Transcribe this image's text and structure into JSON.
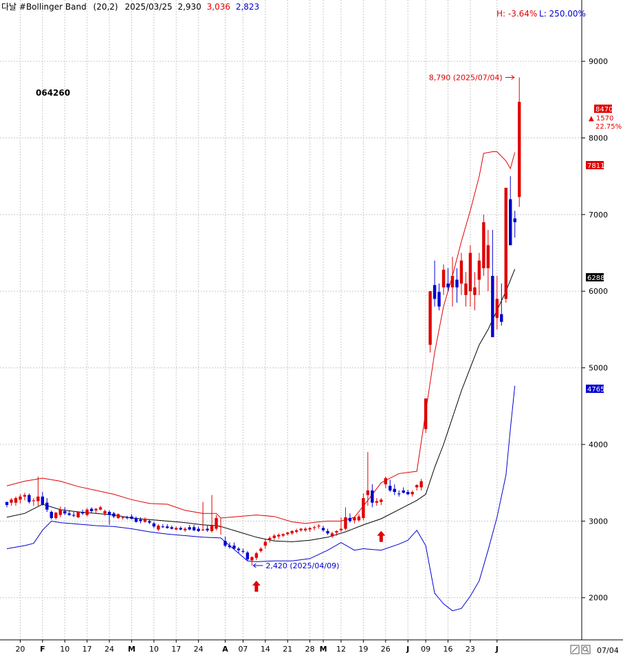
{
  "chart_data": {
    "type": "candlestick",
    "header": {
      "name": "다날 #Bollinger Band",
      "params": "(20,2)",
      "date": "2025/03/25",
      "value1": "2,930",
      "value2": "3,036",
      "value3": "2,823"
    },
    "hl_stats": {
      "high": "H: -3.64%",
      "low": "L: 250.00%"
    },
    "code": "064260",
    "ylim": [
      1450,
      9800
    ],
    "y_ticks": [
      {
        "value": 2000,
        "label": "2000"
      },
      {
        "value": 3000,
        "label": "3000"
      },
      {
        "value": 4000,
        "label": "4000"
      },
      {
        "value": 5000,
        "label": "5000"
      },
      {
        "value": 6000,
        "label": "6000"
      },
      {
        "value": 7000,
        "label": "7000"
      },
      {
        "value": 8000,
        "label": "8000"
      },
      {
        "value": 9000,
        "label": "9000"
      }
    ],
    "x_ticks": [
      {
        "label": "20",
        "index": 3
      },
      {
        "label": "F",
        "index": 8,
        "bold": true
      },
      {
        "label": "10",
        "index": 13
      },
      {
        "label": "17",
        "index": 18
      },
      {
        "label": "24",
        "index": 23
      },
      {
        "label": "M",
        "index": 28,
        "bold": true
      },
      {
        "label": "10",
        "index": 33
      },
      {
        "label": "17",
        "index": 38
      },
      {
        "label": "24",
        "index": 43
      },
      {
        "label": "A",
        "index": 49,
        "bold": true
      },
      {
        "label": "07",
        "index": 53
      },
      {
        "label": "14",
        "index": 58
      },
      {
        "label": "21",
        "index": 63
      },
      {
        "label": "28",
        "index": 68
      },
      {
        "label": "M",
        "index": 71,
        "bold": true
      },
      {
        "label": "12",
        "index": 75
      },
      {
        "label": "19",
        "index": 80
      },
      {
        "label": "26",
        "index": 85
      },
      {
        "label": "J",
        "index": 90,
        "bold": true
      },
      {
        "label": "09",
        "index": 94
      },
      {
        "label": "16",
        "index": 99
      },
      {
        "label": "23",
        "index": 104
      },
      {
        "label": "J",
        "index": 110,
        "bold": true
      }
    ],
    "last_date_label": "07/04",
    "right_labels": {
      "upper": "7811",
      "middle": "6288",
      "lower": "4765",
      "close": "8470",
      "change": "▲ 1570",
      "change_pct": "22.75%"
    },
    "high_annotation": {
      "label": "8,790 (2025/07/04)",
      "value": 8790,
      "index": 114
    },
    "low_annotation": {
      "label": "2,420 (2025/04/09)",
      "value": 2420,
      "index": 55
    },
    "arrows": [
      {
        "index": 56,
        "value": 2150
      },
      {
        "index": 84,
        "value": 2800
      }
    ],
    "candles": [
      [
        3250,
        3250,
        3180,
        3210
      ],
      [
        3240,
        3300,
        3200,
        3280
      ],
      [
        3240,
        3320,
        3200,
        3300
      ],
      [
        3280,
        3350,
        3230,
        3320
      ],
      [
        3320,
        3370,
        3270,
        3340
      ],
      [
        3340,
        3360,
        3230,
        3250
      ],
      [
        3260,
        3300,
        3200,
        3270
      ],
      [
        3260,
        3580,
        3200,
        3320
      ],
      [
        3320,
        3380,
        3200,
        3220
      ],
      [
        3240,
        3300,
        3120,
        3150
      ],
      [
        3120,
        3140,
        3020,
        3040
      ],
      [
        3040,
        3120,
        3020,
        3110
      ],
      [
        3080,
        3190,
        3050,
        3150
      ],
      [
        3130,
        3180,
        3080,
        3100
      ],
      [
        3100,
        3140,
        3070,
        3080
      ],
      [
        3080,
        3120,
        3050,
        3070
      ],
      [
        3050,
        3130,
        3040,
        3120
      ],
      [
        3120,
        3150,
        3080,
        3100
      ],
      [
        3080,
        3170,
        3060,
        3150
      ],
      [
        3160,
        3180,
        3110,
        3130
      ],
      [
        3140,
        3170,
        3100,
        3160
      ],
      [
        3150,
        3200,
        3140,
        3180
      ],
      [
        3100,
        3150,
        3070,
        3130
      ],
      [
        3120,
        3140,
        2950,
        3080
      ],
      [
        3100,
        3120,
        3040,
        3060
      ],
      [
        3040,
        3100,
        3030,
        3090
      ],
      [
        3040,
        3060,
        3020,
        3050
      ],
      [
        3050,
        3070,
        3020,
        3040
      ],
      [
        3060,
        3090,
        3020,
        3030
      ],
      [
        3040,
        3060,
        2980,
        2990
      ],
      [
        3020,
        3050,
        2970,
        3000
      ],
      [
        2990,
        3050,
        2980,
        3030
      ],
      [
        3000,
        3020,
        2960,
        2980
      ],
      [
        2970,
        2990,
        2910,
        2930
      ],
      [
        2890,
        2960,
        2870,
        2940
      ],
      [
        2930,
        2960,
        2910,
        2920
      ],
      [
        2930,
        2960,
        2900,
        2910
      ],
      [
        2920,
        2940,
        2890,
        2900
      ],
      [
        2890,
        2930,
        2880,
        2910
      ],
      [
        2910,
        2930,
        2880,
        2890
      ],
      [
        2880,
        2920,
        2860,
        2900
      ],
      [
        2920,
        2950,
        2880,
        2890
      ],
      [
        2920,
        2950,
        2870,
        2880
      ],
      [
        2900,
        2930,
        2860,
        2870
      ],
      [
        2880,
        3250,
        2870,
        2890
      ],
      [
        2900,
        2940,
        2860,
        2880
      ],
      [
        2870,
        3340,
        2850,
        2940
      ],
      [
        2900,
        3080,
        2880,
        3040
      ],
      [
        2930,
        3036,
        2823,
        2930
      ],
      [
        2740,
        2800,
        2660,
        2680
      ],
      [
        2680,
        2720,
        2640,
        2660
      ],
      [
        2680,
        2720,
        2630,
        2640
      ],
      [
        2640,
        2660,
        2580,
        2620
      ],
      [
        2610,
        2640,
        2580,
        2600
      ],
      [
        2590,
        2610,
        2480,
        2500
      ],
      [
        2490,
        2540,
        2420,
        2530
      ],
      [
        2520,
        2600,
        2490,
        2580
      ],
      [
        2610,
        2660,
        2590,
        2640
      ],
      [
        2680,
        2760,
        2640,
        2730
      ],
      [
        2760,
        2800,
        2720,
        2780
      ],
      [
        2780,
        2830,
        2750,
        2810
      ],
      [
        2800,
        2840,
        2770,
        2820
      ],
      [
        2810,
        2840,
        2790,
        2830
      ],
      [
        2830,
        2860,
        2810,
        2850
      ],
      [
        2840,
        2880,
        2820,
        2870
      ],
      [
        2860,
        2900,
        2840,
        2880
      ],
      [
        2880,
        2910,
        2860,
        2900
      ],
      [
        2880,
        2920,
        2860,
        2900
      ],
      [
        2890,
        2920,
        2860,
        2910
      ],
      [
        2910,
        2940,
        2880,
        2920
      ],
      [
        2930,
        2960,
        2900,
        2940
      ],
      [
        2910,
        2940,
        2860,
        2880
      ],
      [
        2870,
        2900,
        2820,
        2840
      ],
      [
        2800,
        2860,
        2780,
        2840
      ],
      [
        2850,
        2880,
        2810,
        2870
      ],
      [
        2880,
        3050,
        2860,
        2900
      ],
      [
        2900,
        3180,
        2880,
        3050
      ],
      [
        3040,
        3100,
        2980,
        3000
      ],
      [
        3010,
        3060,
        2970,
        3050
      ],
      [
        3010,
        3090,
        2990,
        3060
      ],
      [
        3040,
        3360,
        3010,
        3300
      ],
      [
        3340,
        3900,
        3200,
        3400
      ],
      [
        3400,
        3480,
        3180,
        3240
      ],
      [
        3240,
        3300,
        3200,
        3260
      ],
      [
        3250,
        3300,
        3210,
        3280
      ],
      [
        3480,
        3580,
        3430,
        3560
      ],
      [
        3460,
        3540,
        3380,
        3400
      ],
      [
        3420,
        3480,
        3340,
        3380
      ],
      [
        3360,
        3400,
        3320,
        3350
      ],
      [
        3400,
        3440,
        3360,
        3370
      ],
      [
        3380,
        3410,
        3340,
        3350
      ],
      [
        3350,
        3400,
        3320,
        3380
      ],
      [
        3440,
        3480,
        3400,
        3470
      ],
      [
        3440,
        3550,
        3400,
        3520
      ],
      [
        4200,
        4600,
        4150,
        4600
      ],
      [
        5300,
        6000,
        5200,
        6000
      ],
      [
        6080,
        6400,
        5800,
        5900
      ],
      [
        5990,
        6100,
        5750,
        5800
      ],
      [
        6050,
        6350,
        5950,
        6280
      ],
      [
        6100,
        6300,
        6000,
        6050
      ],
      [
        6050,
        6450,
        5800,
        6200
      ],
      [
        6150,
        6300,
        5850,
        6050
      ],
      [
        6100,
        6500,
        5950,
        6400
      ],
      [
        5950,
        6250,
        5800,
        6100
      ],
      [
        6000,
        6600,
        5800,
        6500
      ],
      [
        5950,
        6250,
        5750,
        6050
      ],
      [
        6150,
        6500,
        5950,
        6400
      ],
      [
        6300,
        7000,
        6200,
        6900
      ],
      [
        6300,
        6800,
        6000,
        6600
      ],
      [
        6200,
        6800,
        5500,
        5400
      ],
      [
        5650,
        6200,
        5500,
        5900
      ],
      [
        5700,
        6100,
        5550,
        5600
      ],
      [
        5900,
        7300,
        5850,
        7350
      ],
      [
        7200,
        7500,
        6600,
        6600
      ],
      [
        6950,
        7050,
        6700,
        6900
      ],
      [
        7230,
        8790,
        7100,
        8470
      ]
    ],
    "bb_upper": [
      [
        0,
        3460
      ],
      [
        4,
        3520
      ],
      [
        8,
        3560
      ],
      [
        12,
        3520
      ],
      [
        16,
        3450
      ],
      [
        20,
        3400
      ],
      [
        24,
        3350
      ],
      [
        28,
        3280
      ],
      [
        32,
        3230
      ],
      [
        36,
        3220
      ],
      [
        40,
        3140
      ],
      [
        44,
        3100
      ],
      [
        47,
        3100
      ],
      [
        48,
        3040
      ],
      [
        52,
        3060
      ],
      [
        56,
        3080
      ],
      [
        60,
        3060
      ],
      [
        64,
        2990
      ],
      [
        67,
        2970
      ],
      [
        70,
        2990
      ],
      [
        72,
        3000
      ],
      [
        75,
        3000
      ],
      [
        78,
        3050
      ],
      [
        81,
        3270
      ],
      [
        84,
        3500
      ],
      [
        88,
        3620
      ],
      [
        92,
        3650
      ],
      [
        96,
        5200
      ],
      [
        98,
        5800
      ],
      [
        100,
        6200
      ],
      [
        102,
        6650
      ],
      [
        104,
        7050
      ],
      [
        106,
        7500
      ],
      [
        107,
        7800
      ],
      [
        109,
        7820
      ],
      [
        110,
        7820
      ],
      [
        112,
        7700
      ],
      [
        113,
        7600
      ],
      [
        114,
        7811
      ]
    ],
    "bb_middle": [
      [
        0,
        3050
      ],
      [
        4,
        3100
      ],
      [
        8,
        3220
      ],
      [
        12,
        3150
      ],
      [
        16,
        3120
      ],
      [
        20,
        3100
      ],
      [
        24,
        3080
      ],
      [
        28,
        3040
      ],
      [
        32,
        3020
      ],
      [
        36,
        3000
      ],
      [
        40,
        2980
      ],
      [
        44,
        2950
      ],
      [
        47,
        2940
      ],
      [
        48,
        2930
      ],
      [
        52,
        2860
      ],
      [
        56,
        2790
      ],
      [
        60,
        2740
      ],
      [
        64,
        2730
      ],
      [
        68,
        2750
      ],
      [
        72,
        2790
      ],
      [
        76,
        2860
      ],
      [
        80,
        2950
      ],
      [
        84,
        3030
      ],
      [
        88,
        3150
      ],
      [
        92,
        3270
      ],
      [
        94,
        3350
      ],
      [
        96,
        3700
      ],
      [
        98,
        4000
      ],
      [
        100,
        4350
      ],
      [
        102,
        4700
      ],
      [
        104,
        5000
      ],
      [
        106,
        5300
      ],
      [
        108,
        5500
      ],
      [
        110,
        5750
      ],
      [
        112,
        6000
      ],
      [
        114,
        6288
      ]
    ],
    "bb_lower": [
      [
        0,
        2640
      ],
      [
        4,
        2680
      ],
      [
        6,
        2710
      ],
      [
        8,
        2880
      ],
      [
        10,
        3000
      ],
      [
        12,
        2980
      ],
      [
        16,
        2960
      ],
      [
        20,
        2940
      ],
      [
        24,
        2930
      ],
      [
        28,
        2900
      ],
      [
        32,
        2860
      ],
      [
        36,
        2830
      ],
      [
        40,
        2810
      ],
      [
        44,
        2790
      ],
      [
        48,
        2780
      ],
      [
        52,
        2580
      ],
      [
        54,
        2480
      ],
      [
        56,
        2470
      ],
      [
        60,
        2480
      ],
      [
        64,
        2480
      ],
      [
        68,
        2510
      ],
      [
        72,
        2620
      ],
      [
        75,
        2720
      ],
      [
        78,
        2620
      ],
      [
        80,
        2640
      ],
      [
        84,
        2620
      ],
      [
        88,
        2700
      ],
      [
        90,
        2750
      ],
      [
        92,
        2880
      ],
      [
        94,
        2680
      ],
      [
        96,
        2060
      ],
      [
        98,
        1920
      ],
      [
        100,
        1830
      ],
      [
        102,
        1860
      ],
      [
        104,
        2020
      ],
      [
        106,
        2220
      ],
      [
        108,
        2620
      ],
      [
        110,
        3050
      ],
      [
        112,
        3600
      ],
      [
        113,
        4200
      ],
      [
        114,
        4765
      ]
    ]
  }
}
